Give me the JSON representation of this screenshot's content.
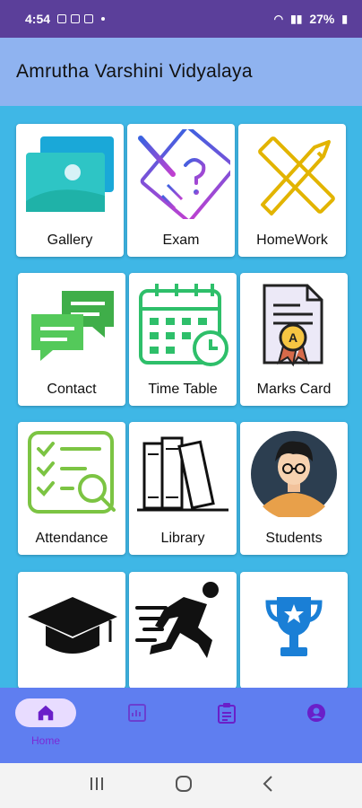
{
  "status_bar": {
    "time": "4:54",
    "battery": "27%"
  },
  "header": {
    "title": "Amrutha Varshini Vidyalaya"
  },
  "tiles": [
    {
      "label": "Gallery",
      "icon": "gallery-icon"
    },
    {
      "label": "Exam",
      "icon": "exam-icon"
    },
    {
      "label": "HomeWork",
      "icon": "homework-icon"
    },
    {
      "label": "Contact",
      "icon": "contact-icon"
    },
    {
      "label": "Time Table",
      "icon": "time-table-icon"
    },
    {
      "label": "Marks Card",
      "icon": "marks-card-icon"
    },
    {
      "label": "Attendance",
      "icon": "attendance-icon"
    },
    {
      "label": "Library",
      "icon": "library-icon"
    },
    {
      "label": "Students",
      "icon": "students-icon"
    },
    {
      "label": "",
      "icon": "graduation-cap-icon"
    },
    {
      "label": "",
      "icon": "runner-icon"
    },
    {
      "label": "",
      "icon": "trophy-icon"
    }
  ],
  "bottom_nav": {
    "items": [
      {
        "label": "Home",
        "icon": "home-icon",
        "active": true
      },
      {
        "label": "",
        "icon": "report-icon",
        "active": false
      },
      {
        "label": "",
        "icon": "clipboard-icon",
        "active": false
      },
      {
        "label": "",
        "icon": "profile-icon",
        "active": false
      }
    ]
  },
  "colors": {
    "status_bar": "#5b3f9a",
    "header": "#8fb3f0",
    "background": "#3fb7e6",
    "bottom_nav": "#5f7ef0",
    "accent": "#7a2ad6"
  }
}
